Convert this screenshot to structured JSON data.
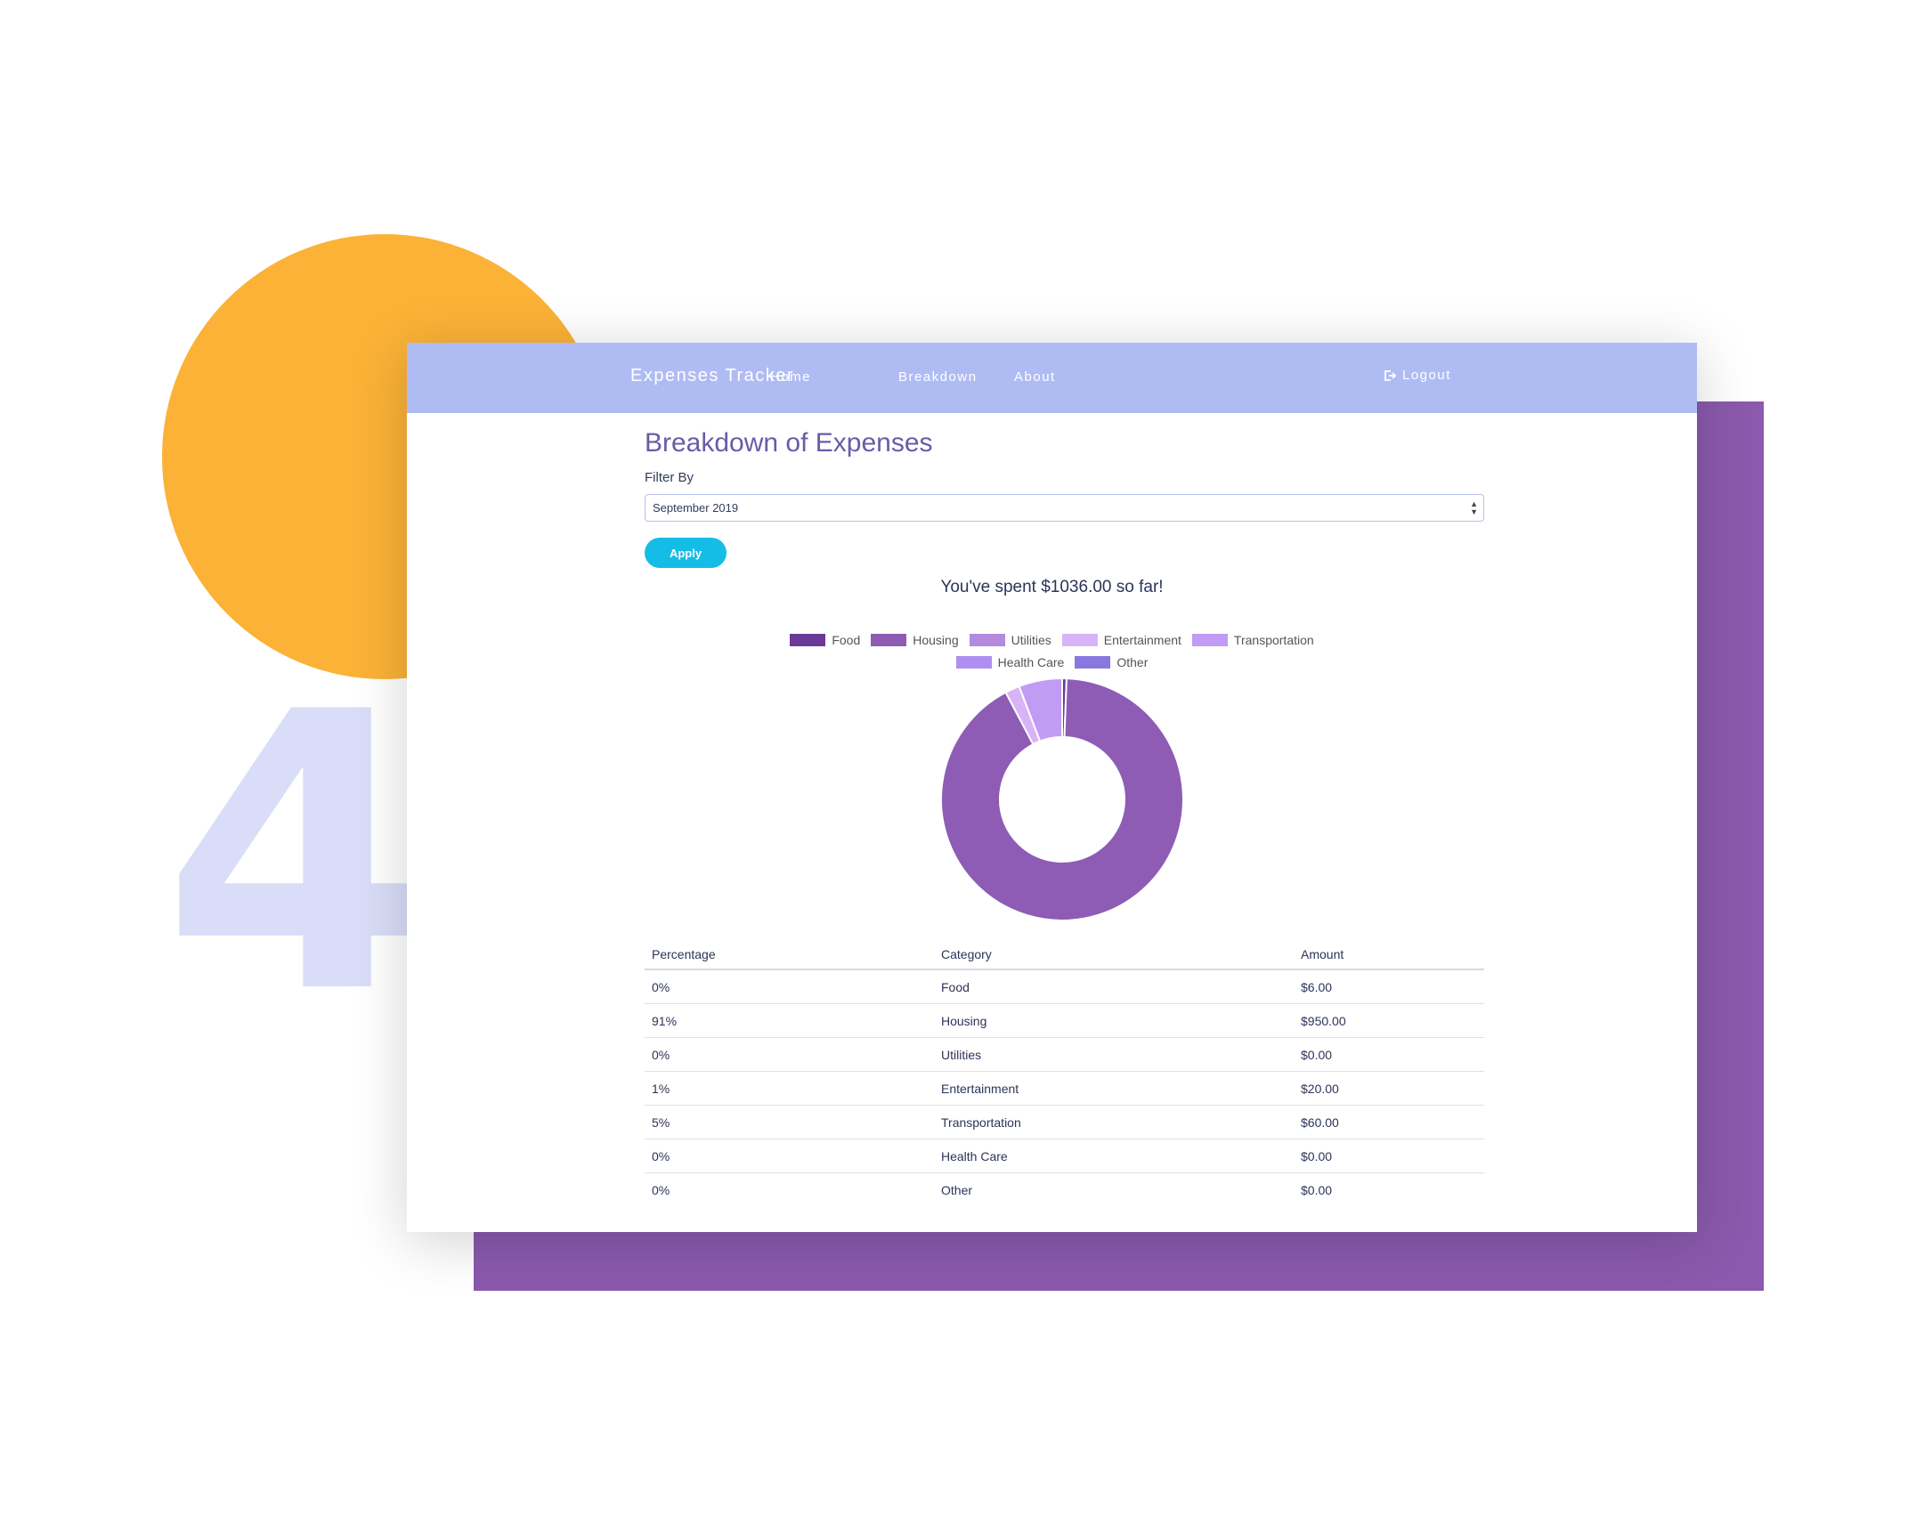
{
  "decoration": {
    "digit": "4",
    "circle_color": "#fbb236",
    "rect_color": "#8b59ad",
    "digit_color": "#d9ddf7"
  },
  "navbar": {
    "brand": "Expenses Tracker",
    "links": [
      "Home",
      "Breakdown",
      "About"
    ],
    "logout_label": "Logout",
    "background": "#afbcf4"
  },
  "page": {
    "title": "Breakdown of Expenses",
    "filter_label": "Filter By",
    "filter_value": "September 2019",
    "apply_label": "Apply",
    "summary": "You've spent $1036.00 so far!"
  },
  "chart_data": {
    "type": "doughnut",
    "categories": [
      "Food",
      "Housing",
      "Utilities",
      "Entertainment",
      "Transportation",
      "Health Care",
      "Other"
    ],
    "values": [
      6.0,
      950.0,
      0.0,
      20.0,
      60.0,
      0.0,
      0.0
    ],
    "colors": [
      "#6b3a99",
      "#8e5cb4",
      "#b38ae0",
      "#d9b3f7",
      "#c29bf5",
      "#ae8ff2",
      "#8a78e0"
    ],
    "legend_position": "top"
  },
  "table": {
    "headers": [
      "Percentage",
      "Category",
      "Amount"
    ],
    "rows": [
      [
        "0%",
        "Food",
        "$6.00"
      ],
      [
        "91%",
        "Housing",
        "$950.00"
      ],
      [
        "0%",
        "Utilities",
        "$0.00"
      ],
      [
        "1%",
        "Entertainment",
        "$20.00"
      ],
      [
        "5%",
        "Transportation",
        "$60.00"
      ],
      [
        "0%",
        "Health Care",
        "$0.00"
      ],
      [
        "0%",
        "Other",
        "$0.00"
      ]
    ]
  }
}
